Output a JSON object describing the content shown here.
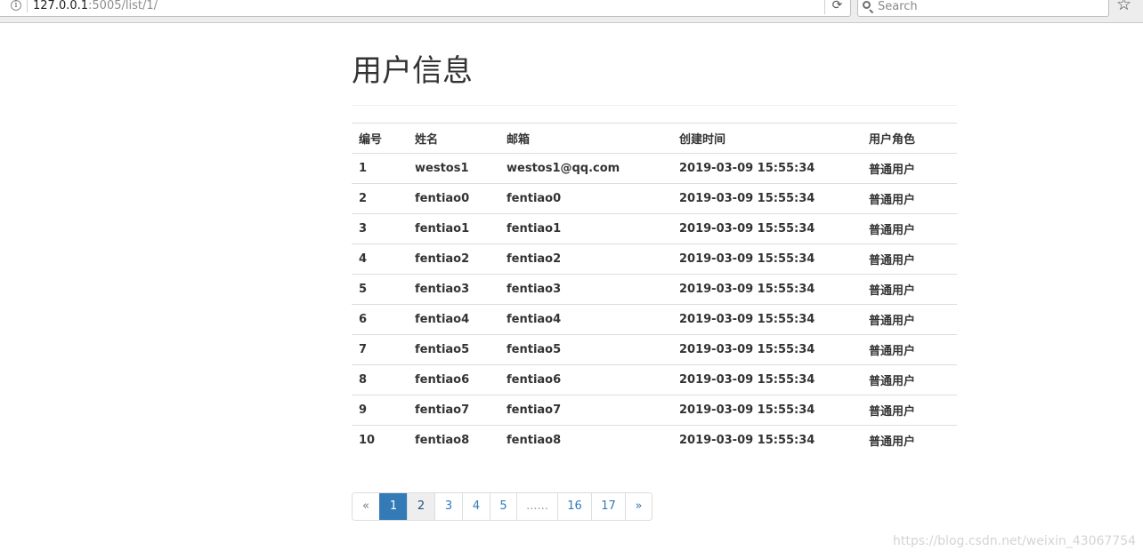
{
  "browser": {
    "url_host": "127.0.0.1",
    "url_rest": ":5005/list/1/",
    "search_placeholder": "Search",
    "icons": [
      "info-icon",
      "reload-icon",
      "search-icon",
      "star-icon"
    ]
  },
  "page": {
    "title": "用户信息"
  },
  "table": {
    "headers": [
      "编号",
      "姓名",
      "邮箱",
      "创建时间",
      "用户角色"
    ],
    "rows": [
      [
        "1",
        "westos1",
        "westos1@qq.com",
        "2019-03-09 15:55:34",
        "普通用户"
      ],
      [
        "2",
        "fentiao0",
        "fentiao0",
        "2019-03-09 15:55:34",
        "普通用户"
      ],
      [
        "3",
        "fentiao1",
        "fentiao1",
        "2019-03-09 15:55:34",
        "普通用户"
      ],
      [
        "4",
        "fentiao2",
        "fentiao2",
        "2019-03-09 15:55:34",
        "普通用户"
      ],
      [
        "5",
        "fentiao3",
        "fentiao3",
        "2019-03-09 15:55:34",
        "普通用户"
      ],
      [
        "6",
        "fentiao4",
        "fentiao4",
        "2019-03-09 15:55:34",
        "普通用户"
      ],
      [
        "7",
        "fentiao5",
        "fentiao5",
        "2019-03-09 15:55:34",
        "普通用户"
      ],
      [
        "8",
        "fentiao6",
        "fentiao6",
        "2019-03-09 15:55:34",
        "普通用户"
      ],
      [
        "9",
        "fentiao7",
        "fentiao7",
        "2019-03-09 15:55:34",
        "普通用户"
      ],
      [
        "10",
        "fentiao8",
        "fentiao8",
        "2019-03-09 15:55:34",
        "普通用户"
      ]
    ]
  },
  "pagination": {
    "items": [
      {
        "label": "«",
        "state": "disabled"
      },
      {
        "label": "1",
        "state": "active"
      },
      {
        "label": "2",
        "state": "hover"
      },
      {
        "label": "3",
        "state": "normal"
      },
      {
        "label": "4",
        "state": "normal"
      },
      {
        "label": "5",
        "state": "normal"
      },
      {
        "label": "......",
        "state": "ellipsis"
      },
      {
        "label": "16",
        "state": "normal"
      },
      {
        "label": "17",
        "state": "normal"
      },
      {
        "label": "»",
        "state": "normal"
      }
    ]
  },
  "watermark": "https://blog.csdn.net/weixin_43067754",
  "colors": {
    "accent": "#337ab7",
    "text": "#333333",
    "border": "#dddddd"
  }
}
